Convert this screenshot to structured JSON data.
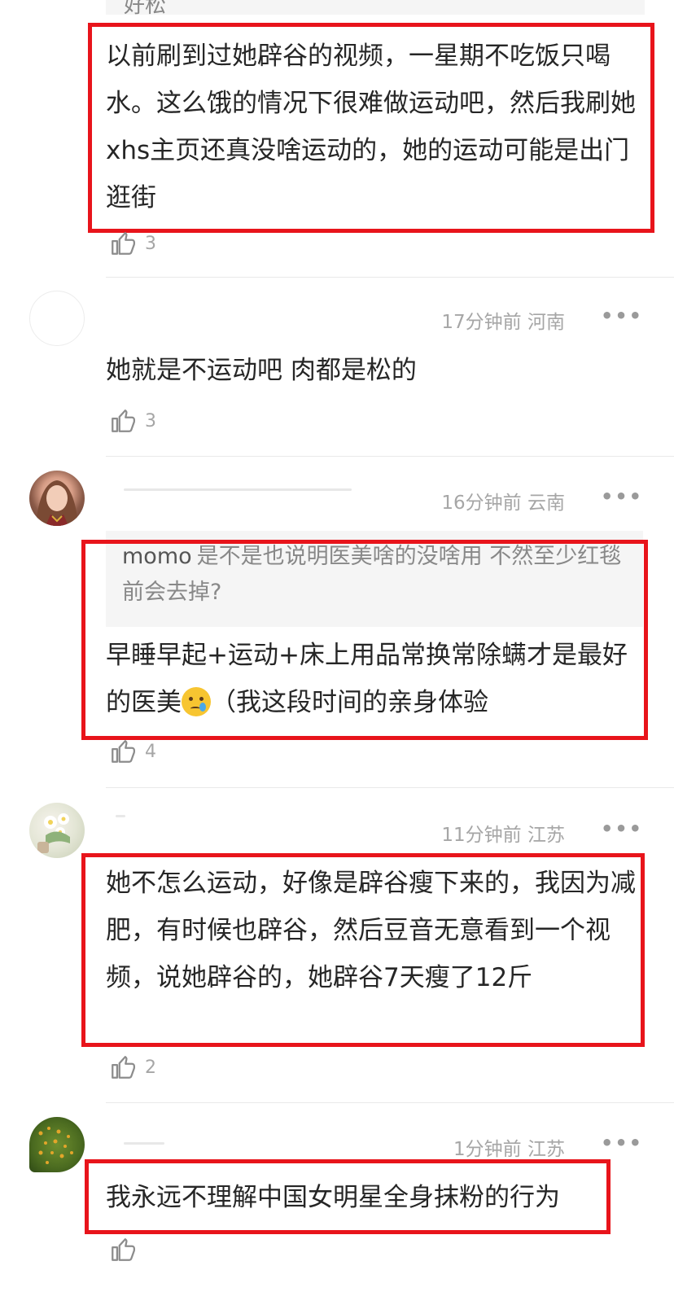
{
  "top_partial": {
    "quote_text": "好松",
    "body": "以前刷到过她辟谷的视频，一星期不吃饭只喝水。这么饿的情况下很难做运动吧，然后我刷她xhs主页还真没啥运动的，她的运动可能是出门逛街",
    "likes": "3"
  },
  "comments": [
    {
      "time": "17分钟前",
      "region": "河南",
      "body": "她就是不运动吧 肉都是松的",
      "likes": "3"
    },
    {
      "time": "16分钟前",
      "region": "云南",
      "reply_name": "momo",
      "reply_text": "是不是也说明医美啥的没啥用 不然至少红毯前会去掉?",
      "body_part1": "早睡早起+运动+床上用品常换常除螨才是最好的医美",
      "emoji": "crying-emoji",
      "body_part2": "（我这段时间的亲身体验",
      "likes": "4"
    },
    {
      "time": "11分钟前",
      "region": "江苏",
      "body": "她不怎么运动，好像是辟谷瘦下来的，我因为减肥，有时候也辟谷，然后豆音无意看到一个视频，说她辟谷的，她辟谷7天瘦了12斤",
      "likes": "2"
    },
    {
      "time": "1分钟前",
      "region": "江苏",
      "body": "我永远不理解中国女明星全身抹粉的行为",
      "likes": ""
    }
  ],
  "more_label": "•••",
  "colors": {
    "highlight": "#e8141b",
    "meta": "#a6a6a6"
  }
}
